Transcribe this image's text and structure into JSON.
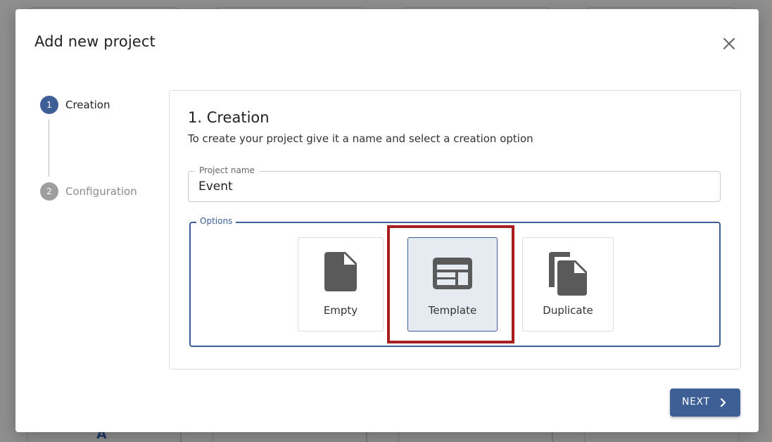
{
  "modal": {
    "title": "Add new project"
  },
  "stepper": {
    "steps": [
      {
        "number": "1",
        "label": "Creation",
        "state": "active"
      },
      {
        "number": "2",
        "label": "Configuration",
        "state": "inactive"
      }
    ]
  },
  "creation": {
    "title": "1. Creation",
    "description": "To create your project give it a name and select a creation option",
    "project_name_label": "Project name",
    "project_name_value": "Event",
    "options_label": "Options",
    "options": [
      {
        "label": "Empty",
        "icon": "file-icon",
        "selected": false
      },
      {
        "label": "Template",
        "icon": "template-icon",
        "selected": true
      },
      {
        "label": "Duplicate",
        "icon": "copy-icon",
        "selected": false
      }
    ]
  },
  "footer": {
    "next_label": "NEXT"
  },
  "background": {
    "letter": "A"
  },
  "colors": {
    "primary": "#3e5f96",
    "selected_bg": "#e6ebf2",
    "highlight": "#a81e1e",
    "icon": "#5a5a5a"
  }
}
